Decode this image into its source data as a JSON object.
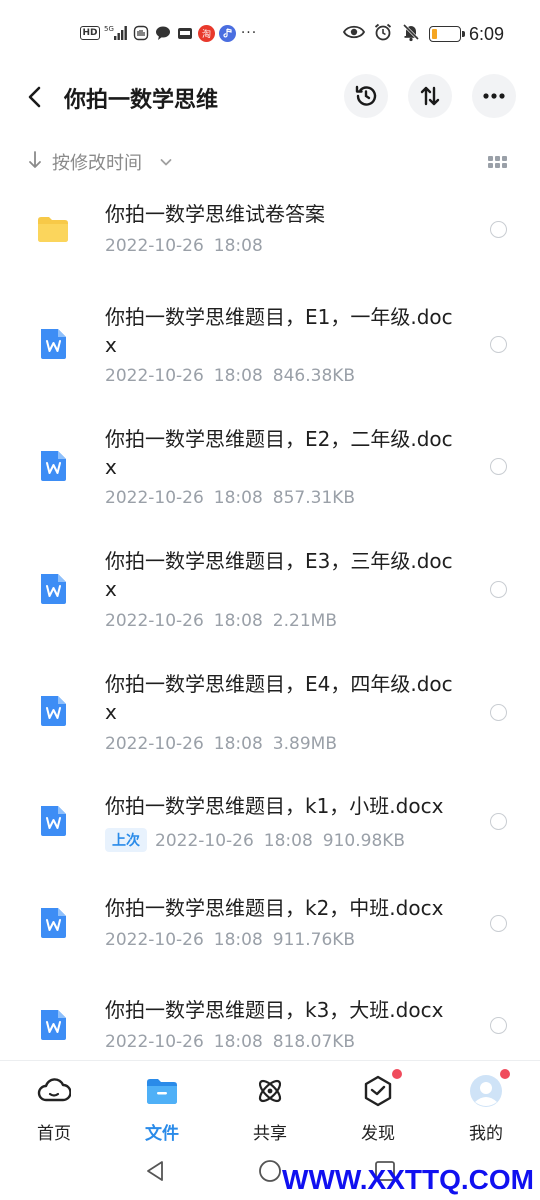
{
  "status_bar": {
    "hd": "HD",
    "signal": "5G",
    "dots": "···",
    "notif_tao": "淘",
    "time": "6:09",
    "battery_level": 0.2
  },
  "header": {
    "title": "你拍一数学思维"
  },
  "sort": {
    "label": "按修改时间"
  },
  "files": [
    {
      "type": "folder",
      "name": "你拍一数学思维试卷答案",
      "date": "2022-10-26",
      "time": "18:08",
      "size": "",
      "badge": ""
    },
    {
      "type": "doc",
      "name": "你拍一数学思维题目，E1，一年级.docx",
      "date": "2022-10-26",
      "time": "18:08",
      "size": "846.38KB",
      "badge": ""
    },
    {
      "type": "doc",
      "name": "你拍一数学思维题目，E2，二年级.docx",
      "date": "2022-10-26",
      "time": "18:08",
      "size": "857.31KB",
      "badge": ""
    },
    {
      "type": "doc",
      "name": "你拍一数学思维题目，E3，三年级.docx",
      "date": "2022-10-26",
      "time": "18:08",
      "size": "2.21MB",
      "badge": ""
    },
    {
      "type": "doc",
      "name": "你拍一数学思维题目，E4，四年级.docx",
      "date": "2022-10-26",
      "time": "18:08",
      "size": "3.89MB",
      "badge": ""
    },
    {
      "type": "doc",
      "name": "你拍一数学思维题目，k1，小班.docx",
      "date": "2022-10-26",
      "time": "18:08",
      "size": "910.98KB",
      "badge": "上次"
    },
    {
      "type": "doc",
      "name": "你拍一数学思维题目，k2，中班.docx",
      "date": "2022-10-26",
      "time": "18:08",
      "size": "911.76KB",
      "badge": ""
    },
    {
      "type": "doc",
      "name": "你拍一数学思维题目，k3，大班.docx",
      "date": "2022-10-26",
      "time": "18:08",
      "size": "818.07KB",
      "badge": ""
    }
  ],
  "bottom_nav": [
    {
      "label": "首页",
      "icon": "home-cloud-icon",
      "active": false
    },
    {
      "label": "文件",
      "icon": "folder-icon",
      "active": true
    },
    {
      "label": "共享",
      "icon": "share-atom-icon",
      "active": false
    },
    {
      "label": "发现",
      "icon": "discover-cube-icon",
      "active": false
    },
    {
      "label": "我的",
      "icon": "avatar-icon",
      "active": false
    }
  ],
  "watermark": "WWW.XXTTQ.COM",
  "colors": {
    "accent": "#2a8be9",
    "folder": "#f7c948",
    "doc_icon": "#3d8df5",
    "red_dot": "#f04b5c"
  }
}
